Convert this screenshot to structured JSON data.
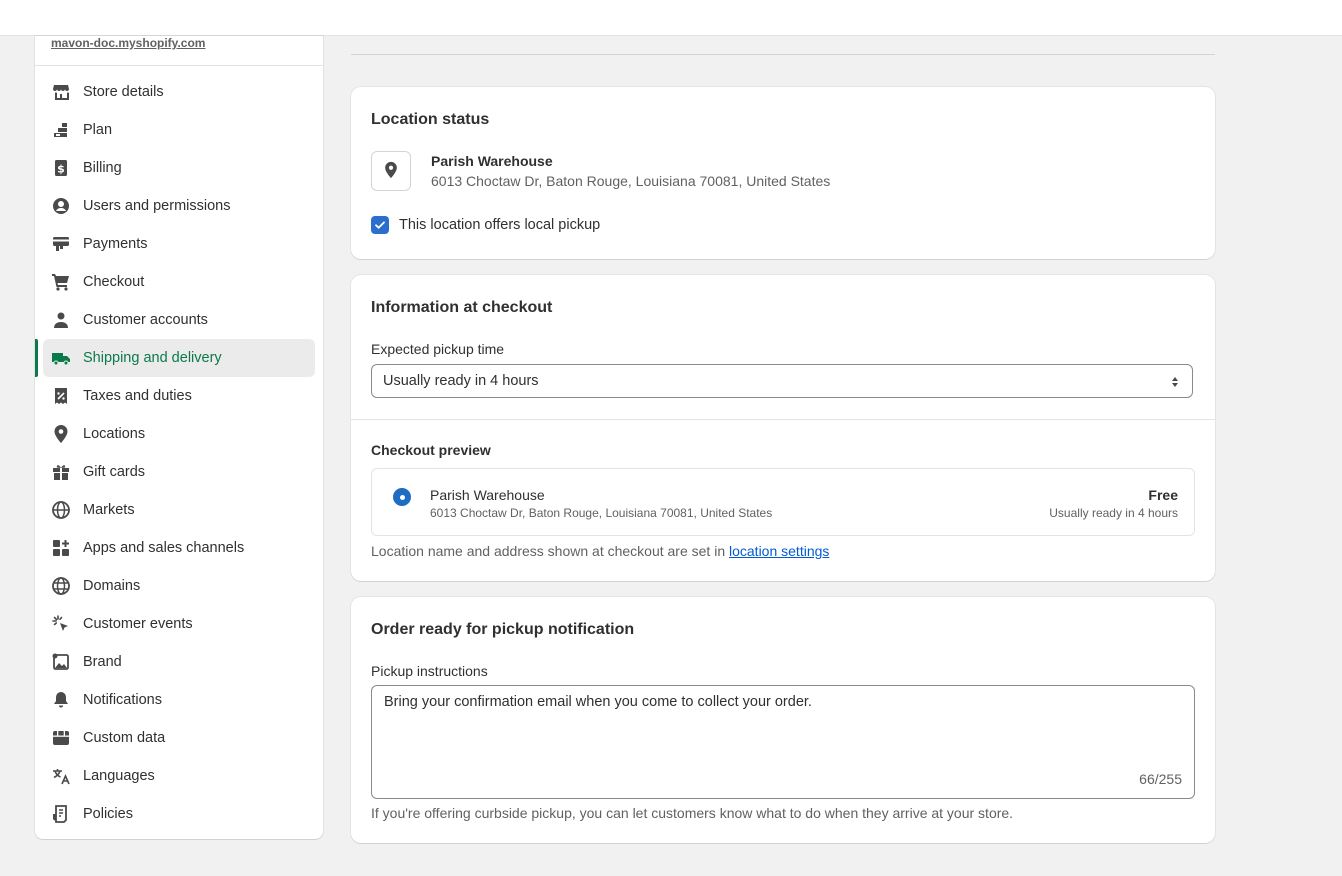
{
  "sidebar": {
    "store_url": "mavon-doc.myshopify.com",
    "items": [
      {
        "label": "Store details",
        "icon": "store-icon"
      },
      {
        "label": "Plan",
        "icon": "plan-icon"
      },
      {
        "label": "Billing",
        "icon": "billing-icon"
      },
      {
        "label": "Users and permissions",
        "icon": "user-circle-icon"
      },
      {
        "label": "Payments",
        "icon": "payments-icon"
      },
      {
        "label": "Checkout",
        "icon": "cart-icon"
      },
      {
        "label": "Customer accounts",
        "icon": "person-icon"
      },
      {
        "label": "Shipping and delivery",
        "icon": "truck-icon",
        "active": true
      },
      {
        "label": "Taxes and duties",
        "icon": "tax-icon"
      },
      {
        "label": "Locations",
        "icon": "location-pin-icon"
      },
      {
        "label": "Gift cards",
        "icon": "gift-icon"
      },
      {
        "label": "Markets",
        "icon": "globe-markets-icon"
      },
      {
        "label": "Apps and sales channels",
        "icon": "apps-icon"
      },
      {
        "label": "Domains",
        "icon": "globe-icon"
      },
      {
        "label": "Customer events",
        "icon": "cursor-click-icon"
      },
      {
        "label": "Brand",
        "icon": "brand-icon"
      },
      {
        "label": "Notifications",
        "icon": "bell-icon"
      },
      {
        "label": "Custom data",
        "icon": "database-icon"
      },
      {
        "label": "Languages",
        "icon": "translate-icon"
      },
      {
        "label": "Policies",
        "icon": "policy-icon"
      }
    ]
  },
  "location_status": {
    "title": "Location status",
    "location_name": "Parish Warehouse",
    "address": "6013 Choctaw Dr, Baton Rouge, Louisiana 70081, United States",
    "checkbox_label": "This location offers local pickup",
    "checked": true
  },
  "info_checkout": {
    "title": "Information at checkout",
    "pickup_time_label": "Expected pickup time",
    "pickup_time_value": "Usually ready in 4 hours",
    "preview_heading": "Checkout preview",
    "preview_name": "Parish Warehouse",
    "preview_address": "6013 Choctaw Dr, Baton Rouge, Louisiana 70081, United States",
    "preview_price": "Free",
    "preview_time": "Usually ready in 4 hours",
    "help_text": "Location name and address shown at checkout are set in ",
    "help_link": "location settings"
  },
  "order_ready": {
    "title": "Order ready for pickup notification",
    "instructions_label": "Pickup instructions",
    "instructions_value": "Bring your confirmation email when you come to collect your order.",
    "char_count": "66/255",
    "help_text": "If you're offering curbside pickup, you can let customers know what to do when they arrive at your store."
  },
  "colors": {
    "accent": "#0b7a4b",
    "link": "#005bd3",
    "checkbox": "#2c6ecb"
  }
}
